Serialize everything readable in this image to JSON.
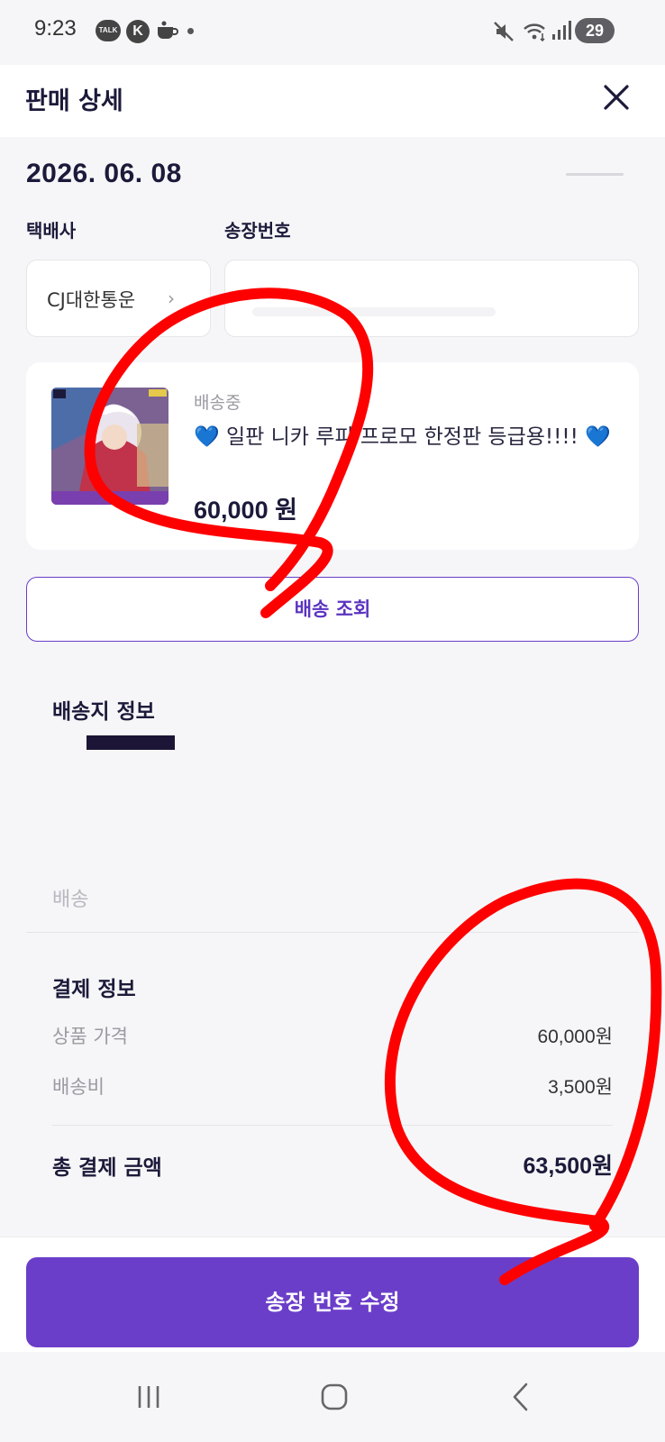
{
  "status_bar": {
    "time": "9:23",
    "talk_badge": "TALK",
    "k_badge": "K",
    "battery": "29"
  },
  "header": {
    "title": "판매 상세"
  },
  "order": {
    "date": "2026. 06. 08"
  },
  "shipping_form": {
    "courier_label": "택배사",
    "courier_value": "CJ대한통운",
    "tracking_label": "송장번호"
  },
  "product": {
    "status": "배송중",
    "name": "💙 일판 니카 루피 프로모 한정판 등급용!!!! 💙",
    "price": "60,000 원"
  },
  "track_button_label": "배송 조회",
  "shipping_info": {
    "title": "배송지 정보",
    "memo_label": "배송"
  },
  "payment": {
    "title": "결제 정보",
    "rows": [
      {
        "label": "상품 가격",
        "value": "60,000원"
      },
      {
        "label": "배송비",
        "value": "3,500원"
      }
    ],
    "total_label": "총 결제 금액",
    "total_value": "63,500원"
  },
  "edit_button_label": "송장 번호 수정",
  "colors": {
    "accent": "#6b3ec9",
    "scribble": "#ff0000"
  }
}
